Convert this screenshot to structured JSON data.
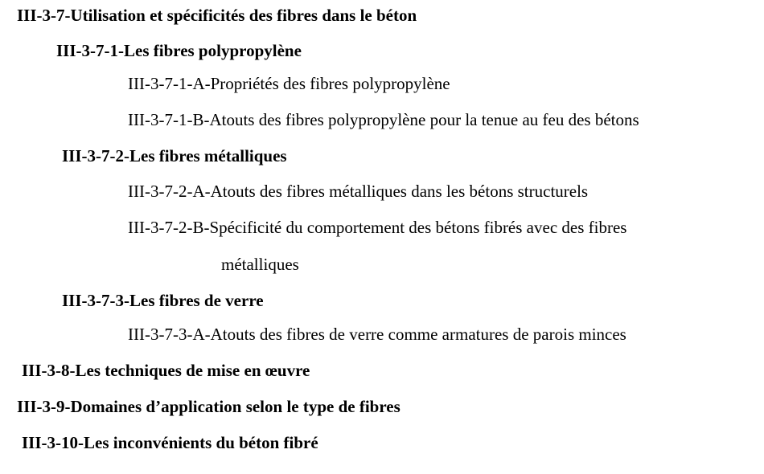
{
  "toc": {
    "entries": [
      {
        "text": "III-3-7-Utilisation et spécificités des fibres dans le béton"
      },
      {
        "text": "III-3-7-1-Les fibres polypropylène"
      },
      {
        "text": "III-3-7-1-A-Propriétés des fibres polypropylène"
      },
      {
        "text": "III-3-7-1-B-Atouts des fibres polypropylène pour la tenue au feu des bétons"
      },
      {
        "text": "III-3-7-2-Les fibres métalliques"
      },
      {
        "text": "III-3-7-2-A-Atouts des fibres métalliques dans les bétons structurels"
      },
      {
        "text": "III-3-7-2-B-Spécificité du comportement des bétons fibrés avec des fibres"
      },
      {
        "text": "métalliques"
      },
      {
        "text": "III-3-7-3-Les fibres de verre"
      },
      {
        "text": "III-3-7-3-A-Atouts des fibres de verre comme armatures de parois minces"
      },
      {
        "text": "III-3-8-Les techniques de mise en œuvre"
      },
      {
        "text": "III-3-9-Domaines d’application selon le type de fibres"
      },
      {
        "text": "III-3-10-Les inconvénients du béton fibré"
      }
    ]
  }
}
